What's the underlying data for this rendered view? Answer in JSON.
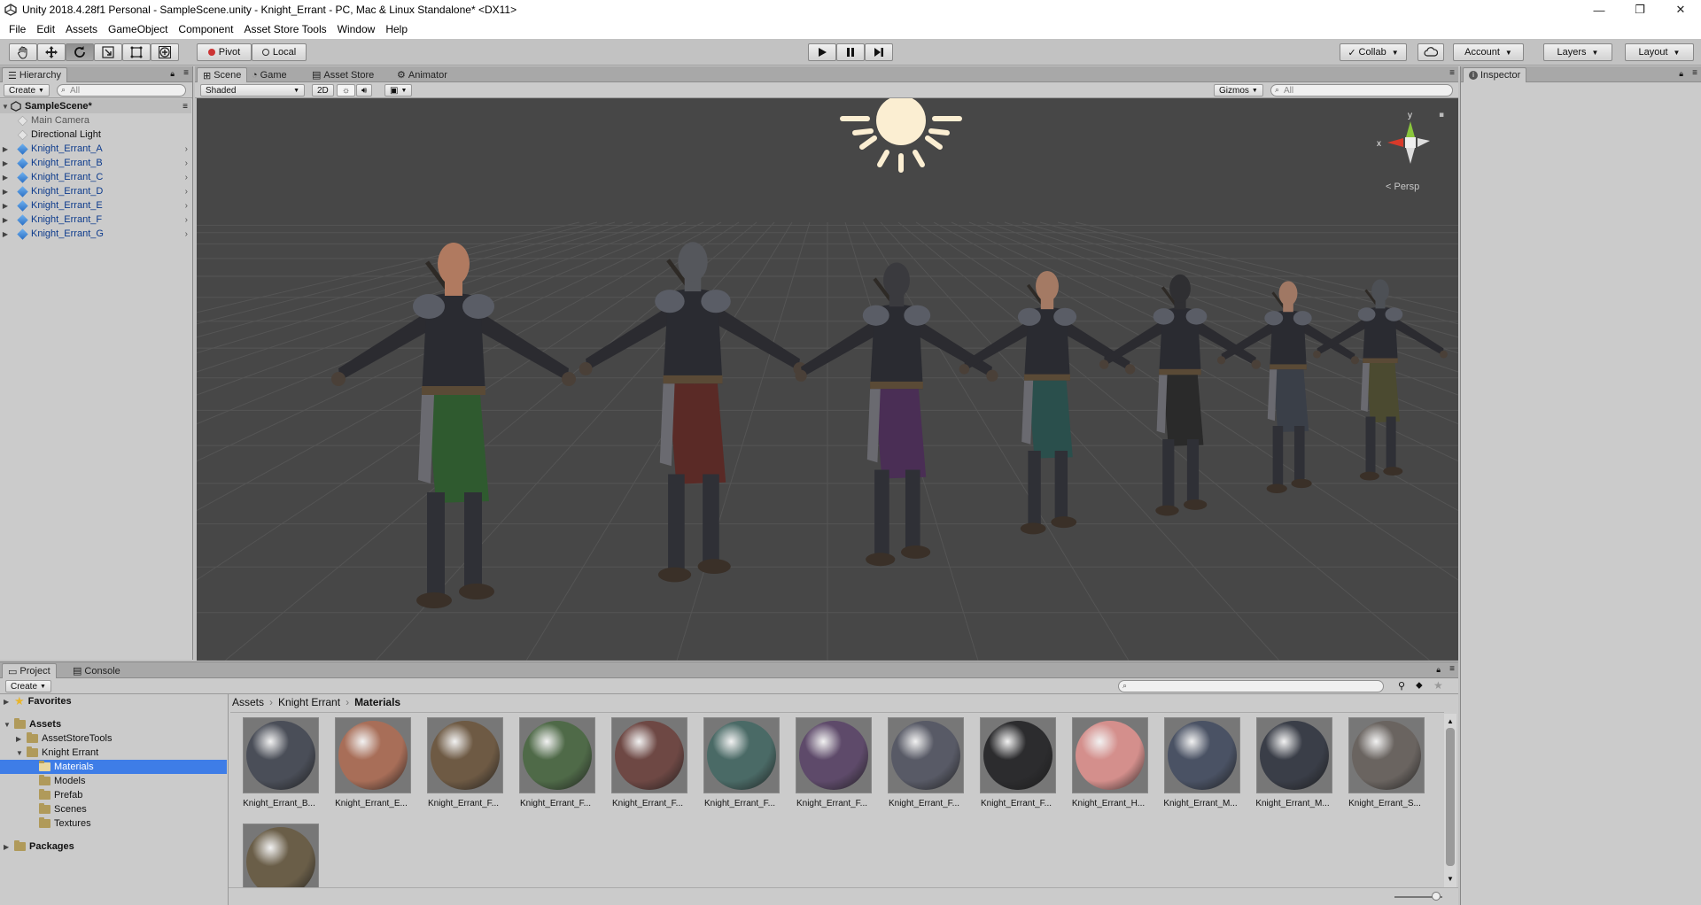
{
  "window": {
    "title": "Unity 2018.4.28f1 Personal - SampleScene.unity - Knight_Errant - PC, Mac & Linux Standalone* <DX11>",
    "minimize": "—",
    "maximize": "❐",
    "close": "✕"
  },
  "menu": [
    "File",
    "Edit",
    "Assets",
    "GameObject",
    "Component",
    "Asset Store Tools",
    "Window",
    "Help"
  ],
  "toolbar": {
    "pivot_label": "Pivot",
    "local_label": "Local",
    "collab_label": "Collab",
    "account_label": "Account",
    "layers_label": "Layers",
    "layout_label": "Layout"
  },
  "hierarchy": {
    "tab_label": "Hierarchy",
    "create_label": "Create",
    "search_placeholder": "All",
    "scene_name": "SampleScene*",
    "items": [
      {
        "label": "Main Camera",
        "kind": "camera"
      },
      {
        "label": "Directional Light",
        "kind": "light"
      },
      {
        "label": "Knight_Errant_A",
        "kind": "prefab"
      },
      {
        "label": "Knight_Errant_B",
        "kind": "prefab"
      },
      {
        "label": "Knight_Errant_C",
        "kind": "prefab"
      },
      {
        "label": "Knight_Errant_D",
        "kind": "prefab"
      },
      {
        "label": "Knight_Errant_E",
        "kind": "prefab"
      },
      {
        "label": "Knight_Errant_F",
        "kind": "prefab"
      },
      {
        "label": "Knight_Errant_G",
        "kind": "prefab"
      }
    ]
  },
  "scene_tabs": {
    "scene": "Scene",
    "game": "Game",
    "asset_store": "Asset Store",
    "animator": "Animator",
    "shading": "Shaded",
    "mode_2d": "2D",
    "gizmos": "Gizmos",
    "search_placeholder": "All",
    "persp_label": "< Persp",
    "axis_y": "y",
    "axis_x": "x"
  },
  "scene_colors": {
    "background": "#474747",
    "grid": "#555555"
  },
  "knights": [
    {
      "skirt": "#2f5a2f",
      "head": "#b07a60"
    },
    {
      "skirt": "#5a2a26",
      "head": "#55575c"
    },
    {
      "skirt": "#4a2e55",
      "head": "#3a3a3e"
    },
    {
      "skirt": "#2a4f4c",
      "head": "#a47a64"
    },
    {
      "skirt": "#2a2a2a",
      "head": "#2f2f32"
    },
    {
      "skirt": "#3a3f48",
      "head": "#a07864"
    },
    {
      "skirt": "#4b4a30",
      "head": "#4d5055"
    }
  ],
  "inspector": {
    "tab_label": "Inspector"
  },
  "project": {
    "tab_label": "Project",
    "console_label": "Console",
    "create_label": "Create",
    "tree": [
      {
        "label": "Favorites",
        "level": 0,
        "bold": true,
        "type": "star",
        "selected": false
      },
      {
        "label": "Assets",
        "level": 0,
        "bold": true,
        "type": "folder",
        "selected": false
      },
      {
        "label": "AssetStoreTools",
        "level": 1,
        "bold": false,
        "type": "folder",
        "selected": false
      },
      {
        "label": "Knight Errant",
        "level": 1,
        "bold": false,
        "type": "folder",
        "selected": false
      },
      {
        "label": "Materials",
        "level": 2,
        "bold": false,
        "type": "folder",
        "selected": true
      },
      {
        "label": "Models",
        "level": 2,
        "bold": false,
        "type": "folder",
        "selected": false
      },
      {
        "label": "Prefab",
        "level": 2,
        "bold": false,
        "type": "folder",
        "selected": false
      },
      {
        "label": "Scenes",
        "level": 2,
        "bold": false,
        "type": "folder",
        "selected": false
      },
      {
        "label": "Textures",
        "level": 2,
        "bold": false,
        "type": "folder",
        "selected": false
      },
      {
        "label": "Packages",
        "level": 0,
        "bold": true,
        "type": "folder",
        "selected": false
      }
    ],
    "breadcrumb": [
      "Assets",
      "Knight Errant",
      "Materials"
    ],
    "assets": [
      {
        "name": "Knight_Errant_B...",
        "color": "#4a4e58"
      },
      {
        "name": "Knight_Errant_E...",
        "color": "#a86e58"
      },
      {
        "name": "Knight_Errant_F...",
        "color": "#6e5a44"
      },
      {
        "name": "Knight_Errant_F...",
        "color": "#4f6a48"
      },
      {
        "name": "Knight_Errant_F...",
        "color": "#6e4844"
      },
      {
        "name": "Knight_Errant_F...",
        "color": "#4a6a66"
      },
      {
        "name": "Knight_Errant_F...",
        "color": "#5e4a6a"
      },
      {
        "name": "Knight_Errant_F...",
        "color": "#585a66"
      },
      {
        "name": "Knight_Errant_F...",
        "color": "#2c2c2e"
      },
      {
        "name": "Knight_Errant_H...",
        "color": "#d48f8c"
      },
      {
        "name": "Knight_Errant_M...",
        "color": "#4a5264"
      },
      {
        "name": "Knight_Errant_M...",
        "color": "#3a3e48"
      },
      {
        "name": "Knight_Errant_S...",
        "color": "#6a6460"
      },
      {
        "name": "",
        "color": "#6a5e48"
      }
    ]
  }
}
